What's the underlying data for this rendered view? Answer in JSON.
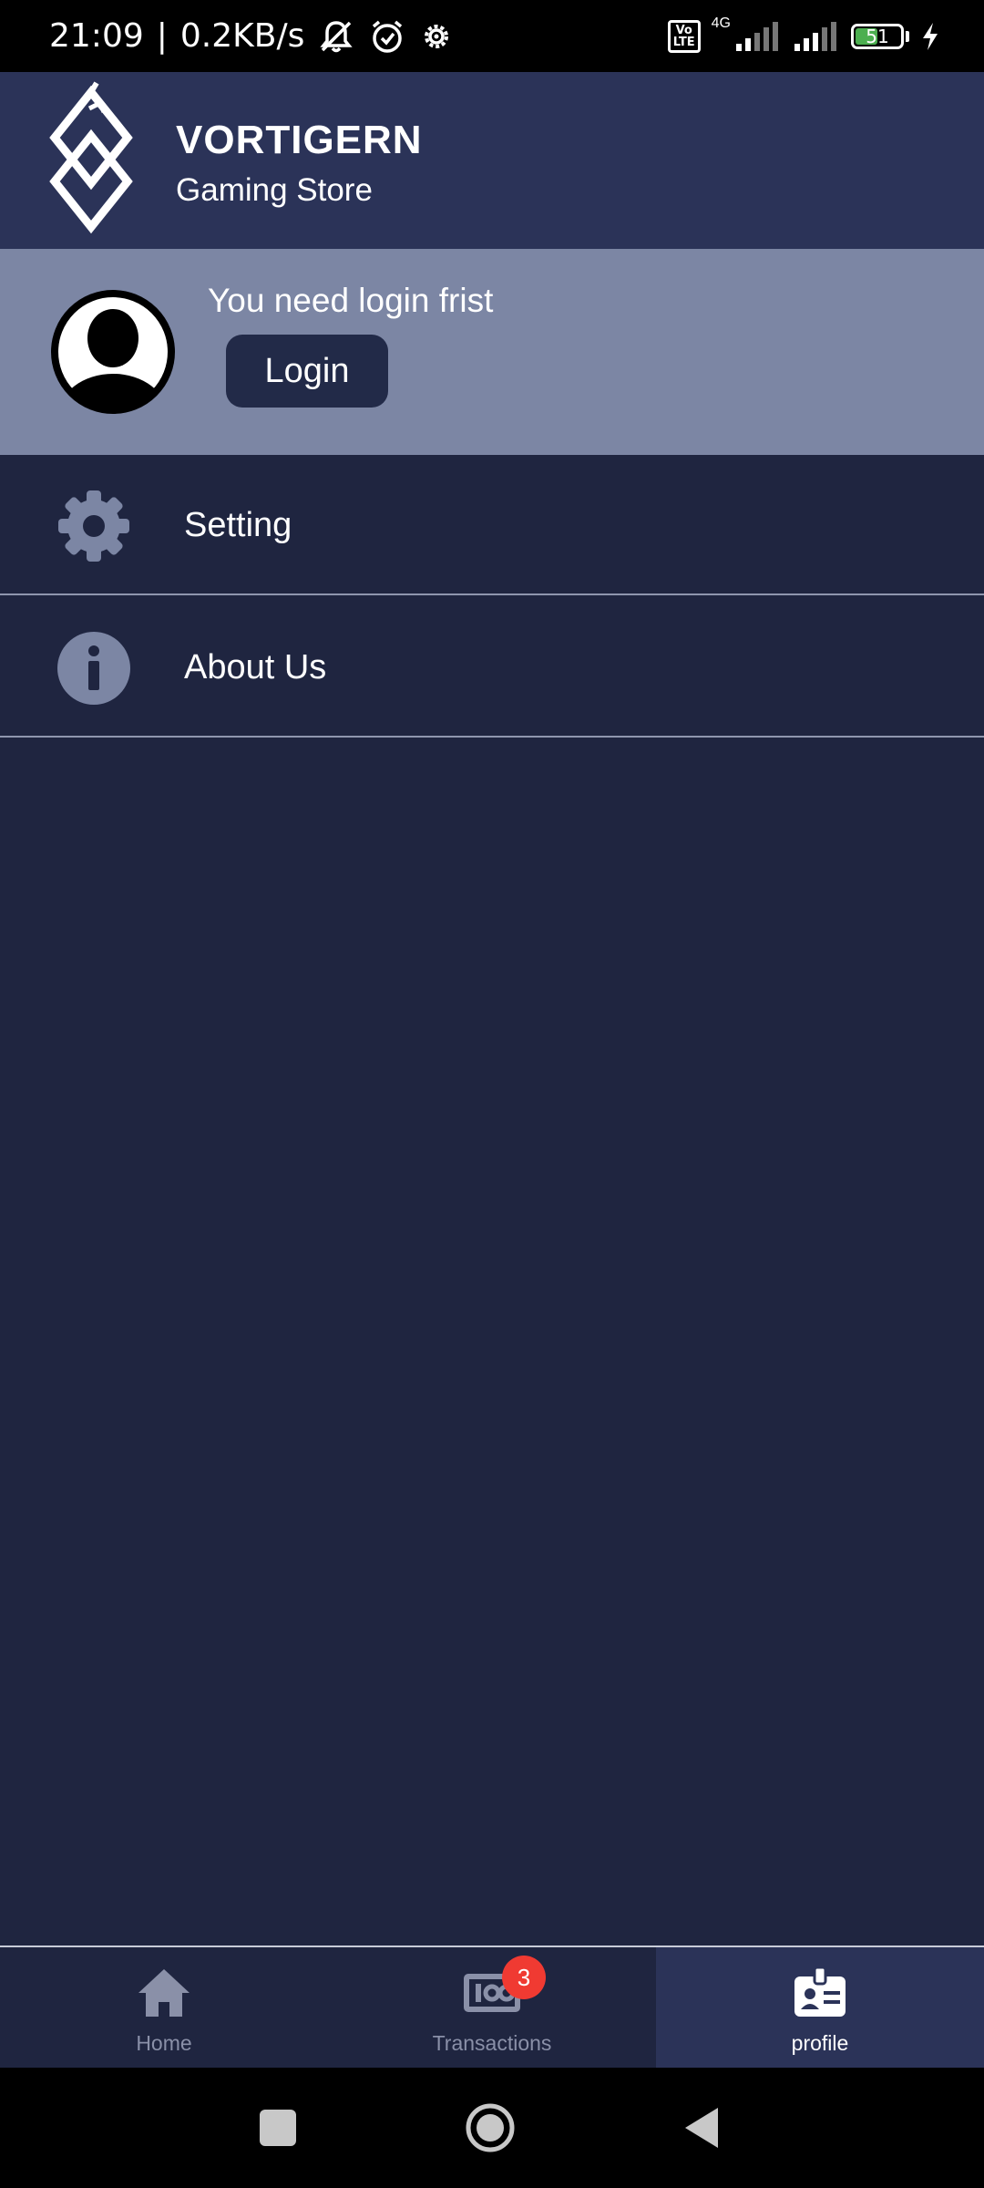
{
  "status_bar": {
    "time": "21:09",
    "separator": "|",
    "speed": "0.2KB/s",
    "network_type": "4G",
    "volte_label": "Vo\nLTE",
    "battery_level": "51",
    "icons": [
      "mute-icon",
      "alarm-icon",
      "settings-gear-icon",
      "volte-icon",
      "signal-icon",
      "signal-icon",
      "battery-icon",
      "charging-icon"
    ]
  },
  "header": {
    "brand_name": "VORTIGERN",
    "brand_subtitle": "Gaming Store",
    "background": "#2b3358"
  },
  "login_section": {
    "prompt": "You need login frist",
    "button_label": "Login",
    "background": "#7c86a4"
  },
  "menu": {
    "items": [
      {
        "label": "Setting",
        "icon": "gear-icon"
      },
      {
        "label": "About Us",
        "icon": "info-icon"
      }
    ]
  },
  "bottom_nav": {
    "items": [
      {
        "label": "Home",
        "icon": "home-icon",
        "active": false
      },
      {
        "label": "Transactions",
        "icon": "transactions-icon",
        "active": false,
        "badge": "3"
      },
      {
        "label": "profile",
        "icon": "profile-card-icon",
        "active": true
      }
    ],
    "active_color": "#ffffff",
    "inactive_color": "#8a90a8",
    "badge_color": "#f03a32"
  },
  "system_nav": {
    "buttons": [
      "recents-square-icon",
      "home-circle-icon",
      "back-triangle-icon"
    ]
  },
  "colors": {
    "page_background": "#1f2540",
    "divider": "#8f96ae",
    "icon_muted": "#7c86a4"
  }
}
